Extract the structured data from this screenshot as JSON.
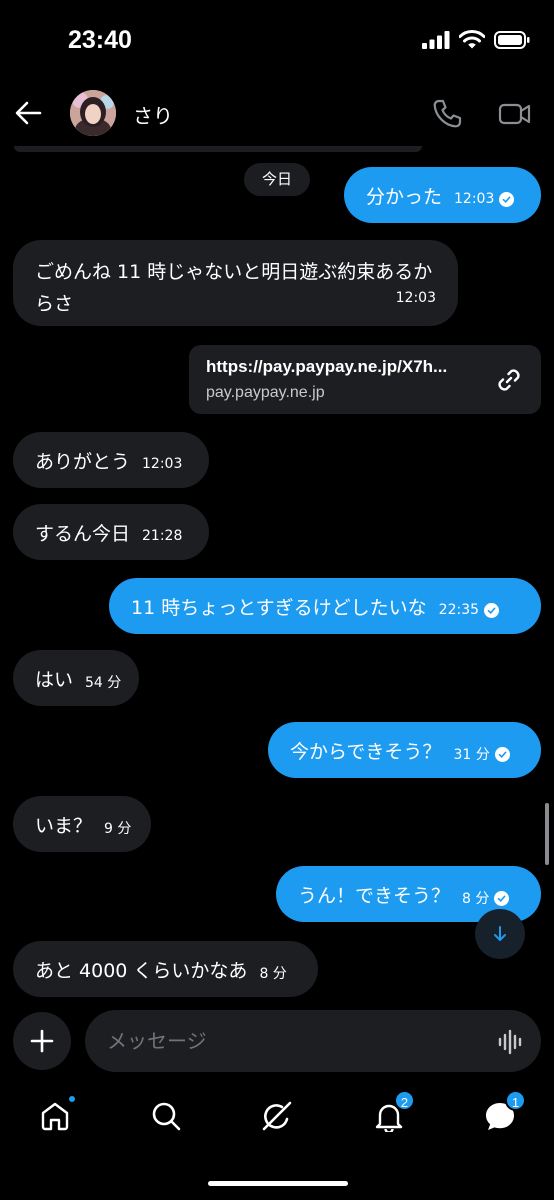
{
  "status_bar": {
    "time": "23:40"
  },
  "header": {
    "contact_name": "さり"
  },
  "date_separator": "今日",
  "messages": [
    {
      "dir": "out",
      "text": "分かった",
      "time": "12:03"
    },
    {
      "dir": "in",
      "text": "ごめんね 11 時じゃないと明日遊ぶ約束あるからさ",
      "time": "12:03"
    },
    {
      "dir": "out",
      "type": "link",
      "url": "https://pay.paypay.ne.jp/X7h...",
      "domain": "pay.paypay.ne.jp"
    },
    {
      "dir": "in",
      "text": "ありがとう",
      "time": "12:03"
    },
    {
      "dir": "in",
      "text": "するん今日",
      "time": "21:28"
    },
    {
      "dir": "out",
      "text": "11 時ちょっとすぎるけどしたいな",
      "time": "22:35"
    },
    {
      "dir": "in",
      "text": "はい",
      "time": "54 分"
    },
    {
      "dir": "out",
      "text": "今からできそう？",
      "time": "31 分"
    },
    {
      "dir": "in",
      "text": "いま？",
      "time": "9 分"
    },
    {
      "dir": "out",
      "text": "うん！できそう？",
      "time": "8 分"
    },
    {
      "dir": "in",
      "text": "あと 4000 くらいかなあ",
      "time": "8 分"
    }
  ],
  "composer": {
    "placeholder": "メッセージ"
  },
  "nav": {
    "notifications_badge": "2",
    "messages_badge": "1"
  },
  "colors": {
    "accent": "#1d9bf0",
    "incoming_bubble": "#1d1e21",
    "background": "#000000"
  },
  "icons": [
    "back-arrow-icon",
    "phone-icon",
    "video-icon",
    "link-icon",
    "arrow-down-icon",
    "plus-icon",
    "waveform-icon",
    "home-icon",
    "search-icon",
    "grok-icon",
    "bell-icon",
    "messages-icon"
  ]
}
